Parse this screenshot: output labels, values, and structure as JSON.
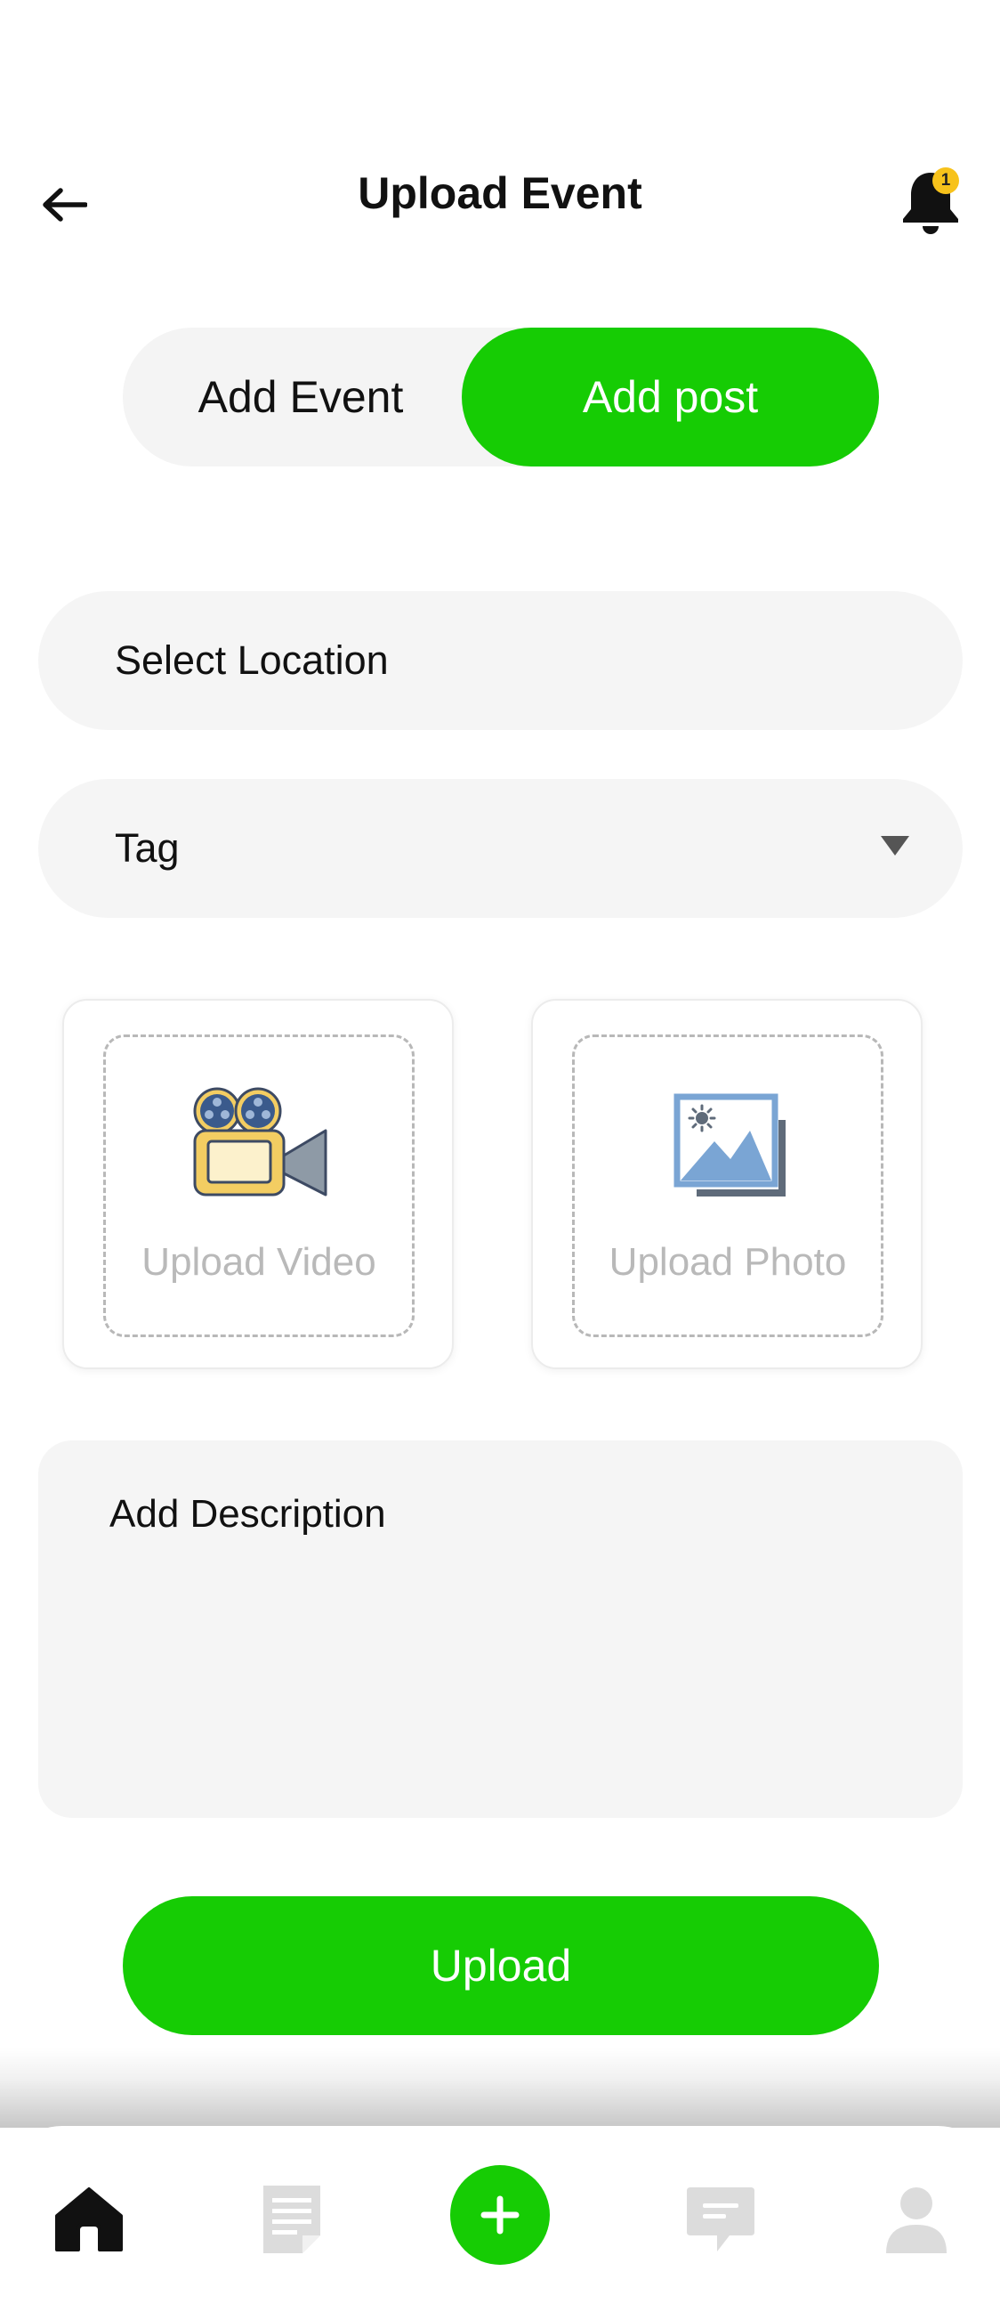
{
  "header": {
    "title": "Upload Event",
    "notification_count": "1"
  },
  "tabs": [
    {
      "label": "Add Event",
      "active": false
    },
    {
      "label": "Add post",
      "active": true
    }
  ],
  "form": {
    "location_placeholder": "Select Location",
    "tag_placeholder": "Tag",
    "upload_video_label": "Upload Video",
    "upload_photo_label": "Upload Photo",
    "description_placeholder": "Add Description",
    "submit_label": "Upload"
  },
  "bottom_nav": [
    {
      "icon": "home-icon",
      "active": true
    },
    {
      "icon": "document-icon",
      "active": false
    },
    {
      "icon": "plus-icon",
      "active": false
    },
    {
      "icon": "chat-icon",
      "active": false
    },
    {
      "icon": "profile-icon",
      "active": false
    }
  ],
  "colors": {
    "accent": "#16cc04",
    "badge": "#f7c21b",
    "field_bg": "#f5f5f5",
    "inactive_icon": "#dcdcdc"
  }
}
